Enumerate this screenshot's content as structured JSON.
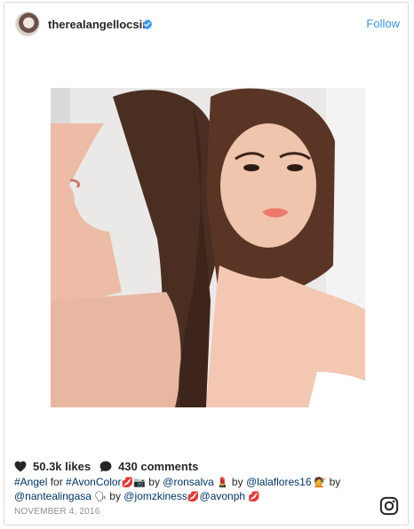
{
  "header": {
    "username": "therealangellocsin",
    "follow_label": "Follow",
    "avatar_icon": "profile-avatar",
    "verified_icon": "verified-badge-icon",
    "verified_color": "#3897f0"
  },
  "post": {
    "image_icon": "portrait-photo"
  },
  "stats": {
    "likes": "50.3k likes",
    "comments": "430 comments",
    "like_icon": "heart-icon",
    "comment_icon": "comment-bubble-icon"
  },
  "caption": {
    "tag1": "#Angel",
    "text1": " for ",
    "tag2": "#AvonColor",
    "emoji1": "💋📷",
    "text2": " by ",
    "mention1": "@ronsalva",
    "emoji2": " 💄",
    "text3": " by ",
    "mention2": "@lalaflores16",
    "emoji3": " 💇",
    "text4": " by ",
    "mention3": "@nantealingasa",
    "emoji4": " 🗣",
    "text5": " by ",
    "mention4": "@jomzkiness",
    "emoji5": "💋",
    "mention5": "@avonph",
    "emoji6": " 💋"
  },
  "date": "NOVEMBER 4, 2016",
  "footer": {
    "brand_icon": "instagram-logo-icon"
  },
  "colors": {
    "link": "#003569",
    "follow": "#3897f0",
    "muted": "#8e8e8e"
  }
}
